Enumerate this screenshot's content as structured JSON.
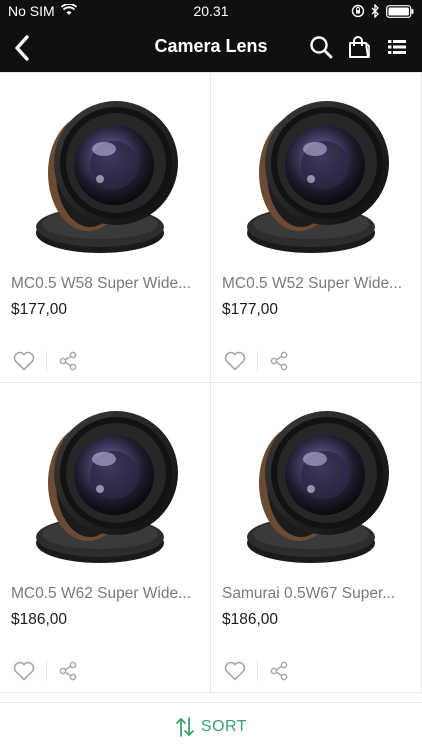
{
  "status_bar": {
    "carrier": "No SIM",
    "time": "20.31"
  },
  "header": {
    "title": "Camera Lens",
    "icons": [
      "back-icon",
      "search-icon",
      "shopping-bag-icon",
      "list-menu-icon"
    ]
  },
  "products": [
    {
      "name": "MC0.5 W58 Super Wide...",
      "price": "$177,00"
    },
    {
      "name": "MC0.5 W52 Super Wide...",
      "price": "$177,00"
    },
    {
      "name": "MC0.5 W62 Super Wide...",
      "price": "$186,00"
    },
    {
      "name": "Samurai 0.5W67 Super...",
      "price": "$186,00"
    }
  ],
  "card_icons": [
    "heart-icon",
    "share-icon"
  ],
  "sort_bar": {
    "label": "SORT",
    "icon": "sort-arrows-icon"
  },
  "colors": {
    "header_bg": "#101010",
    "accent_green": "#3aa26b",
    "name_gray": "#7a7a7a",
    "divider": "#e6e6e6"
  }
}
